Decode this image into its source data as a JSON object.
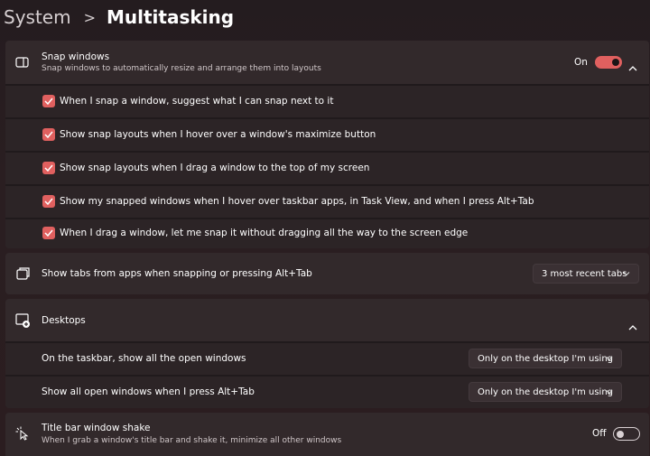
{
  "breadcrumb": {
    "parent": "System",
    "separator": ">",
    "title": "Multitasking"
  },
  "colors": {
    "accent": "#e0605f",
    "card": "#32292b",
    "subcard": "#2c2426"
  },
  "snap": {
    "title": "Snap windows",
    "description": "Snap windows to automatically resize and arrange them into layouts",
    "state_label": "On",
    "options": [
      {
        "label": "When I snap a window, suggest what I can snap next to it",
        "checked": true
      },
      {
        "label": "Show snap layouts when I hover over a window's maximize button",
        "checked": true
      },
      {
        "label": "Show snap layouts when I drag a window to the top of my screen",
        "checked": true
      },
      {
        "label": "Show my snapped windows when I hover over taskbar apps, in Task View, and when I press Alt+Tab",
        "checked": true
      },
      {
        "label": "When I drag a window, let me snap it without dragging all the way to the screen edge",
        "checked": true
      }
    ]
  },
  "tabs": {
    "label": "Show tabs from apps when snapping or pressing Alt+Tab",
    "value": "3 most recent tabs"
  },
  "desktops": {
    "title": "Desktops",
    "rows": [
      {
        "label": "On the taskbar, show all the open windows",
        "value": "Only on the desktop I'm using"
      },
      {
        "label": "Show all open windows when I press Alt+Tab",
        "value": "Only on the desktop I'm using"
      }
    ]
  },
  "shake": {
    "title": "Title bar window shake",
    "description": "When I grab a window's title bar and shake it, minimize all other windows",
    "state_label": "Off"
  }
}
